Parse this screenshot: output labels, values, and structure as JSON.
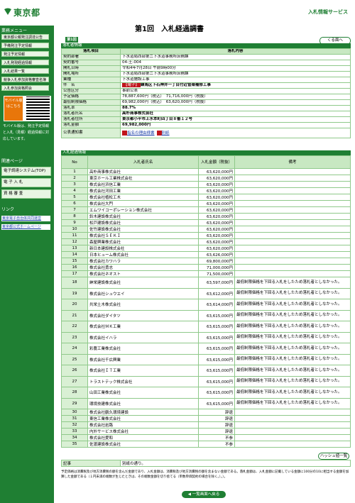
{
  "site": {
    "name": "東京都",
    "service": "入札情報サービス"
  },
  "sidebar": {
    "menu_title": "業務メニュー",
    "items": [
      "東京都公報発注調達公告",
      "予備発注予定情報",
      "発注予定情報",
      "入札発現経過情報",
      "入札結果一覧",
      "競争入札参加資格審査名簿",
      "入札参加資格照会"
    ],
    "mobile_tag": "モバイル版はこちら",
    "mobile_note": "モバイル版は、発注予定情報と入札（見積）経過情報に対応しています。",
    "links_title": "関連ページ",
    "links": [
      "電子調達システム(TOP)",
      "電 子 入 札",
      "資 格 審 査"
    ],
    "related_title": "リンク",
    "related": [
      "東京電子自治体共同運営",
      "東京都公式ホームページ"
    ]
  },
  "page": {
    "title": "第1回　入札経過調書",
    "round_tab": "第1回",
    "back_label": "くる面へ",
    "hash_label": "ハッシュ値一覧",
    "bottom_label": "◀ 一覧画面へ戻る"
  },
  "header": {
    "section": "落札者情報",
    "col_item": "落札項目",
    "col_content": "落札内容",
    "rows": [
      {
        "label": "契約部署",
        "value": "下水道局西部第二下水道事務所庶務課"
      },
      {
        "label": "契約番号",
        "value": "04-土-004"
      },
      {
        "label": "開札日時",
        "value": "令和4年7月28日 午前9時00分"
      },
      {
        "label": "開札場所",
        "value": "下水道局西部第二下水道事務所庶務課"
      },
      {
        "label": "業種",
        "value": "下水道施設工事"
      },
      {
        "label": "件　名",
        "badge": "【電子】",
        "value": "練馬区下石神井一丁目付近管渠補修工事"
      },
      {
        "label": "公告区分",
        "value": "事前公表"
      },
      {
        "label": "予定価格",
        "value": "78,887,600円（税込）　71,716,000円（税抜）"
      },
      {
        "label": "最低制限価格",
        "value": "69,982,000円（税込）　63,620,000円（税抜）"
      },
      {
        "label": "落札率",
        "value": "88.7%"
      },
      {
        "label": "落札者氏名",
        "value": "高朴商事株式会社"
      },
      {
        "label": "落札者住所",
        "value": "東京都小平市上水本町四丁目８番１２号"
      },
      {
        "label": "落札金額",
        "value": "69,982,000円"
      },
      {
        "label": "公表通知書",
        "value": "指名の理由様書",
        "value2": "別紙"
      }
    ]
  },
  "result": {
    "section": "入札経過情報",
    "col_no": "No",
    "col_name": "入札者氏名",
    "col_amount": "入札金額（税抜）",
    "col_note": "備考",
    "rows": [
      {
        "no": "1",
        "name": "高朴商事株式会社",
        "amount": "63,620,000円",
        "note": ""
      },
      {
        "no": "2",
        "name": "東京ホール工業株式会社",
        "amount": "63,620,000円",
        "note": ""
      },
      {
        "no": "3",
        "name": "株式会社浜信工業",
        "amount": "63,620,000円",
        "note": ""
      },
      {
        "no": "4",
        "name": "株式会社河田工業",
        "amount": "63,620,000円",
        "note": ""
      },
      {
        "no": "5",
        "name": "株式会社植松工木",
        "amount": "63,620,000円",
        "note": ""
      },
      {
        "no": "6",
        "name": "株式会社大門",
        "amount": "63,620,000円",
        "note": ""
      },
      {
        "no": "7",
        "name": "エムワイコーポレーション株式会社",
        "amount": "63,620,000円",
        "note": ""
      },
      {
        "no": "8",
        "name": "鈴木建設株式会社",
        "amount": "63,620,000円",
        "note": ""
      },
      {
        "no": "9",
        "name": "松戸建設株式会社",
        "amount": "63,620,000円",
        "note": ""
      },
      {
        "no": "10",
        "name": "佐竹建設株式会社",
        "amount": "63,620,000円",
        "note": ""
      },
      {
        "no": "11",
        "name": "株式会社ＳＥＫＩ",
        "amount": "63,620,000円",
        "note": ""
      },
      {
        "no": "12",
        "name": "森屋興業株式会社",
        "amount": "63,620,000円",
        "note": ""
      },
      {
        "no": "13",
        "name": "新日本建設株式会社",
        "amount": "63,620,000円",
        "note": ""
      },
      {
        "no": "14",
        "name": "日本ヒューム株式会社",
        "amount": "63,626,000円",
        "note": ""
      },
      {
        "no": "15",
        "name": "株式会社カワハラ",
        "amount": "69,800,000円",
        "note": ""
      },
      {
        "no": "16",
        "name": "株式会社勇志",
        "amount": "71,000,000円",
        "note": ""
      },
      {
        "no": "17",
        "name": "株式会社ネオスト",
        "amount": "71,500,000円",
        "note": ""
      },
      {
        "no": "18",
        "name": "紳栄建設株式会社",
        "amount": "63,597,000円",
        "note": "最低制限価格を下回る入札をしたため落札者としなかった。"
      },
      {
        "no": "19",
        "name": "株式会社シュウエイ",
        "amount": "63,612,000円",
        "note": "最低制限価格を下回る入札をしたため落札者としなかった。"
      },
      {
        "no": "20",
        "name": "共栄土木株式会社",
        "amount": "63,614,000円",
        "note": "最低制限価格を下回る入札をしたため落札者としなかった。"
      },
      {
        "no": "21",
        "name": "株式会社ダイタツ",
        "amount": "63,615,000円",
        "note": "最低制限価格を下回る入札をしたため落札者としなかった。"
      },
      {
        "no": "22",
        "name": "株式会社ＭＫ工業",
        "amount": "63,615,000円",
        "note": "最低制限価格を下回る入札をしたため落札者としなかった。"
      },
      {
        "no": "23",
        "name": "株式会社イハラ",
        "amount": "63,615,000円",
        "note": "最低制限価格を下回る入札をしたため落札者としなかった。"
      },
      {
        "no": "24",
        "name": "彩農工業株式会社",
        "amount": "63,615,000円",
        "note": "最低制限価格を下回る入札をしたため落札者としなかった。"
      },
      {
        "no": "25",
        "name": "株式会社千広興業",
        "amount": "63,615,000円",
        "note": "最低制限価格を下回る入札をしたため落札者としなかった。"
      },
      {
        "no": "26",
        "name": "株式会社ＩＴ工業",
        "amount": "63,615,000円",
        "note": "最低制限価格を下回る入札をしたため落札者としなかった。"
      },
      {
        "no": "27",
        "name": "トラストテック株式会社",
        "amount": "63,615,000円",
        "note": "最低制限価格を下回る入札をしたため落札者としなかった。"
      },
      {
        "no": "28",
        "name": "山田工業株式会社",
        "amount": "63,615,000円",
        "note": "最低制限価格を下回る入札をしたため落札者としなかった。"
      },
      {
        "no": "29",
        "name": "環境技建株式会社",
        "amount": "63,615,000円",
        "note": "最低制限価格を下回る入札をしたため落札者としなかった。"
      },
      {
        "no": "30",
        "name": "株式会社鶴久環境建設",
        "amount": "辞退",
        "note": ""
      },
      {
        "no": "31",
        "name": "東信工業株式会社",
        "amount": "辞退",
        "note": ""
      },
      {
        "no": "32",
        "name": "株式会社岩路",
        "amount": "辞退",
        "note": ""
      },
      {
        "no": "33",
        "name": "内外サービス株式会社",
        "amount": "辞退",
        "note": ""
      },
      {
        "no": "34",
        "name": "株式会社愛和",
        "amount": "不参",
        "note": ""
      },
      {
        "no": "35",
        "name": "佐渡建設株式会社",
        "amount": "不参",
        "note": ""
      }
    ]
  },
  "remark": {
    "label": "記事",
    "value": "別紙の通り。"
  },
  "footnote": "予定価格は消費税及び地方消費税の額を含んだ金額であり、入札金額は、消費税及び地方消費税の額を含まない金額である。落札金額は、入札金額に記載している金額に100分の10に相当する金額を加算した金額である（１円未満の端数が生じたときは、その端数金額を切り捨てる（単数単価契約の場合を除く。）。）。"
}
